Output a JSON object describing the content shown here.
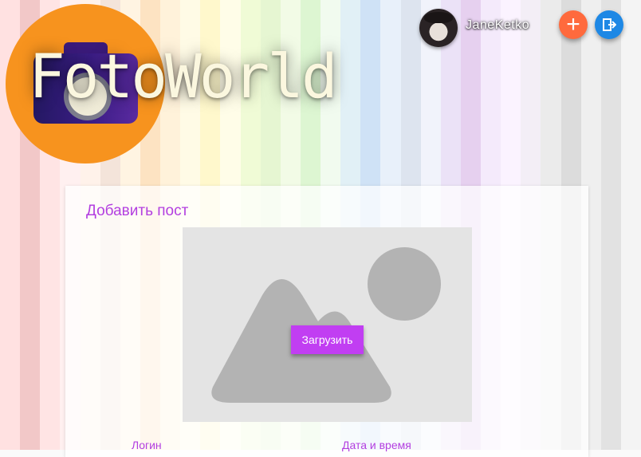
{
  "app": {
    "logo_text": "FotoWorld"
  },
  "header": {
    "username": "JaneKetko",
    "add_icon": "plus-icon",
    "logout_icon": "logout-icon"
  },
  "colors": {
    "accent": "#c13ef2",
    "logo_orange": "#f7931e",
    "add_button": "#ff6a3d",
    "logout_button": "#1e88e5"
  },
  "card": {
    "title": "Добавить пост",
    "upload_label": "Загрузить",
    "placeholder_icon": "image-placeholder-icon",
    "columns": [
      "Логин",
      "Дата и время"
    ]
  }
}
